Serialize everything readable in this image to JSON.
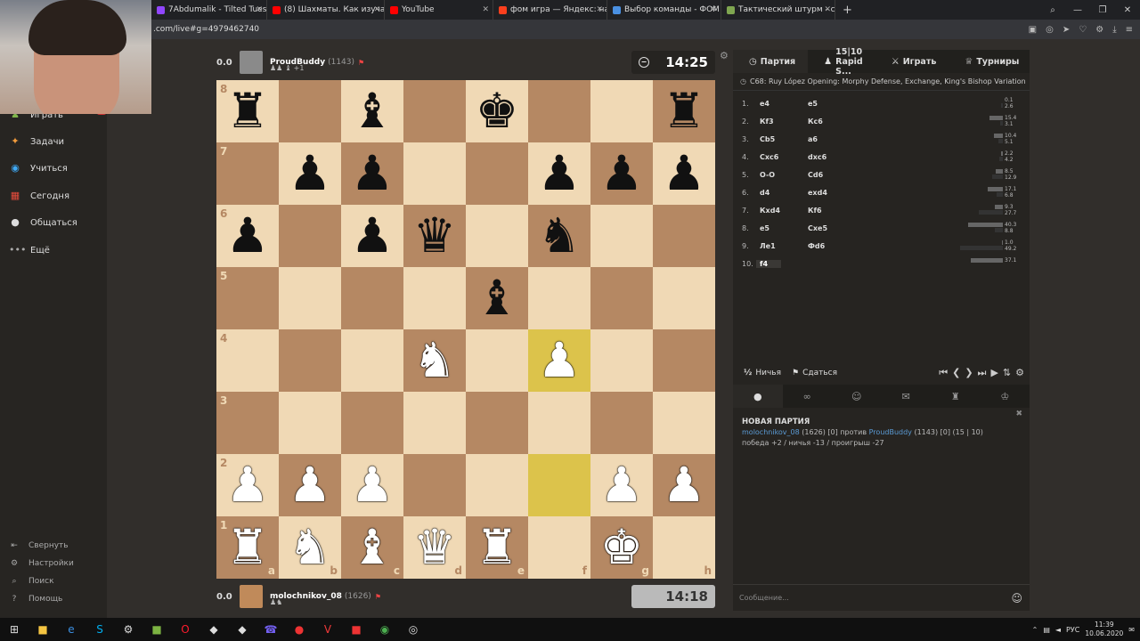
{
  "browser": {
    "tabs": [
      {
        "title": "7Abdumalik - Tilted Tuesd",
        "color": "#9146ff"
      },
      {
        "title": "(8) Шахматы. Как изучать",
        "color": "#ff0000"
      },
      {
        "title": "YouTube",
        "color": "#ff0000"
      },
      {
        "title": "фом игра — Яндекс: нашл",
        "color": "#fc3f1d"
      },
      {
        "title": "Выбор команды - ФОМ",
        "color": "#4a90e2"
      },
      {
        "title": "Тактический штурм - cops",
        "color": "#7fa650"
      }
    ],
    "new_tab": "+",
    "url": ".com/live#g=4979462740"
  },
  "nav": {
    "items": [
      {
        "label": "Играть",
        "icon": "chess-pawn-icon"
      },
      {
        "label": "Задачи",
        "icon": "puzzle-icon"
      },
      {
        "label": "Учиться",
        "icon": "learn-icon"
      },
      {
        "label": "Сегодня",
        "icon": "calendar-icon"
      },
      {
        "label": "Общаться",
        "icon": "chat-icon"
      },
      {
        "label": "Ещё",
        "icon": "more-icon"
      }
    ],
    "bottom": [
      {
        "label": "Свернуть",
        "icon": "collapse-icon"
      },
      {
        "label": "Настройки",
        "icon": "gear-icon"
      },
      {
        "label": "Поиск",
        "icon": "search-icon"
      },
      {
        "label": "Помощь",
        "icon": "help-icon"
      }
    ],
    "badge": "16"
  },
  "top_player": {
    "score": "0.0",
    "name": "ProudBuddy",
    "rating": "(1143)",
    "captured": "+1",
    "clock": "14:25"
  },
  "bottom_player": {
    "score": "0.0",
    "name": "molochnikov_08",
    "rating": "(1626)",
    "clock": "14:18"
  },
  "board": {
    "ranks": [
      "8",
      "7",
      "6",
      "5",
      "4",
      "3",
      "2",
      "1"
    ],
    "files": [
      "a",
      "b",
      "c",
      "d",
      "e",
      "f",
      "g",
      "h"
    ],
    "position": [
      [
        "bR",
        "",
        "bB",
        "",
        "bK",
        "",
        "",
        "bR"
      ],
      [
        "",
        "bP",
        "bP",
        "",
        "",
        "bP",
        "bP",
        "bP"
      ],
      [
        "bP",
        "",
        "bP",
        "bQ",
        "",
        "bN",
        "",
        ""
      ],
      [
        "",
        "",
        "",
        "",
        "bB",
        "",
        "",
        ""
      ],
      [
        "",
        "",
        "",
        "wN",
        "",
        "wP",
        "",
        ""
      ],
      [
        "",
        "",
        "",
        "",
        "",
        "",
        "",
        ""
      ],
      [
        "wP",
        "wP",
        "wP",
        "",
        "",
        "",
        "wP",
        "wP"
      ],
      [
        "wR",
        "wN",
        "wB",
        "wQ",
        "wR",
        "",
        "wK",
        ""
      ]
    ],
    "highlights": [
      "f4",
      "f2"
    ]
  },
  "panel": {
    "tabs": [
      {
        "label": "Партия",
        "icon": "clock-icon"
      },
      {
        "label": "15|10 Rapid S...",
        "icon": "pawn-icon"
      },
      {
        "label": "Играть",
        "icon": "play-icon"
      },
      {
        "label": "Турниры",
        "icon": "trophy-icon"
      }
    ],
    "opening": "C68: Ruy López Opening: Morphy Defense, Exchange, King's Bishop Variation",
    "moves": [
      {
        "n": "1.",
        "w": "e4",
        "b": "e5",
        "tw": "0.1",
        "tb": "2.6",
        "fw": 0.01,
        "fb": 0.05
      },
      {
        "n": "2.",
        "w": "Кf3",
        "b": "Кc6",
        "tw": "15.4",
        "tb": "3.1",
        "fw": 0.31,
        "fb": 0.06
      },
      {
        "n": "3.",
        "w": "Сb5",
        "b": "a6",
        "tw": "10.4",
        "tb": "5.1",
        "fw": 0.21,
        "fb": 0.1
      },
      {
        "n": "4.",
        "w": "Сxc6",
        "b": "dxc6",
        "tw": "2.2",
        "tb": "4.2",
        "fw": 0.05,
        "fb": 0.09
      },
      {
        "n": "5.",
        "w": "O-O",
        "b": "Сd6",
        "tw": "8.5",
        "tb": "12.9",
        "fw": 0.17,
        "fb": 0.26
      },
      {
        "n": "6.",
        "w": "d4",
        "b": "exd4",
        "tw": "17.1",
        "tb": "6.8",
        "fw": 0.35,
        "fb": 0.14
      },
      {
        "n": "7.",
        "w": "Кxd4",
        "b": "Кf6",
        "tw": "9.3",
        "tb": "27.7",
        "fw": 0.19,
        "fb": 0.56
      },
      {
        "n": "8.",
        "w": "e5",
        "b": "Сxe5",
        "tw": "40.3",
        "tb": "8.8",
        "fw": 0.82,
        "fb": 0.18
      },
      {
        "n": "9.",
        "w": "Ле1",
        "b": "Фd6",
        "tw": "1.0",
        "tb": "49.2",
        "fw": 0.02,
        "fb": 1.0
      },
      {
        "n": "10.",
        "w": "f4",
        "b": "",
        "tw": "37.1",
        "tb": "",
        "fw": 0.75,
        "fb": 0
      }
    ],
    "draw_label": "Ничья",
    "draw_icon_text": "½",
    "resign_label": "Сдаться",
    "chat": {
      "header": "НОВАЯ ПАРТИЯ",
      "white_link": "molochnikov_08",
      "line1_mid": " (1626) [0] против ",
      "black_link": "ProudBuddy",
      "line1_tail": " (1143) [0] (15 | 10)",
      "line2": "победа +2 / ничья -13 / проигрыш -27"
    },
    "message_placeholder": "Сообщение..."
  },
  "taskbar": {
    "lang": "РУС",
    "time": "11:39",
    "date": "10.06.2020"
  }
}
